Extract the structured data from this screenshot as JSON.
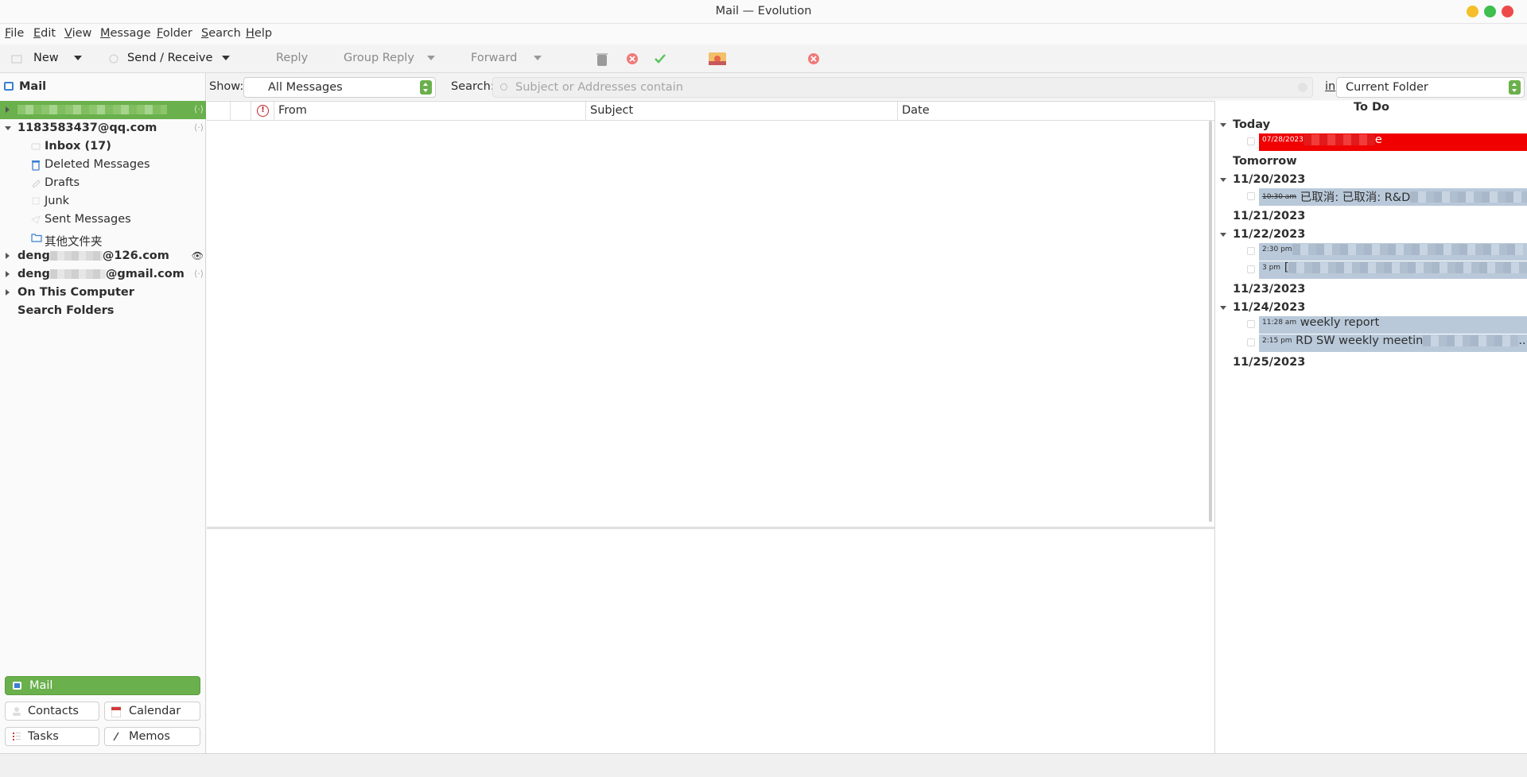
{
  "window": {
    "title": "Mail — Evolution"
  },
  "menu": [
    "File",
    "Edit",
    "View",
    "Message",
    "Folder",
    "Search",
    "Help"
  ],
  "toolbar": {
    "new_label": "New",
    "send_receive_label": "Send / Receive",
    "reply_label": "Reply",
    "group_reply_label": "Group Reply",
    "forward_label": "Forward"
  },
  "sidebar": {
    "header": "Mail",
    "accounts": [
      {
        "label_visible": ""
      },
      {
        "label": "1183583437@qq.com"
      },
      {
        "label_prefix": "deng",
        "label_suffix": "@126.com"
      },
      {
        "label_prefix": "deng",
        "label_suffix": "@gmail.com"
      },
      {
        "label": "On This Computer"
      },
      {
        "label": "Search Folders"
      }
    ],
    "folders": [
      {
        "label": "Inbox (17)",
        "icon": "inbox-icon"
      },
      {
        "label": "Deleted Messages",
        "icon": "trash-icon"
      },
      {
        "label": "Drafts",
        "icon": "drafts-icon"
      },
      {
        "label": "Junk",
        "icon": "junk-icon"
      },
      {
        "label": "Sent Messages",
        "icon": "sent-icon"
      },
      {
        "label": "其他文件夹",
        "icon": "folder-icon"
      }
    ]
  },
  "switcher": {
    "mail": "Mail",
    "contacts": "Contacts",
    "calendar": "Calendar",
    "tasks": "Tasks",
    "memos": "Memos"
  },
  "filter": {
    "show_label": "Show:",
    "show_value": "All Messages",
    "search_label": "Search:",
    "search_placeholder": "Subject or Addresses contain",
    "in_label": "in",
    "scope_value": "Current Folder"
  },
  "message_list": {
    "columns": [
      "From",
      "Subject",
      "Date"
    ]
  },
  "todo": {
    "title": "To Do",
    "days": [
      {
        "label": "Today"
      },
      {
        "label": "Tomorrow"
      },
      {
        "label": "11/20/2023"
      },
      {
        "label": "11/21/2023"
      },
      {
        "label": "11/22/2023"
      },
      {
        "label": "11/23/2023"
      },
      {
        "label": "11/24/2023"
      },
      {
        "label": "11/25/2023"
      }
    ],
    "events": [
      {
        "time": "07/28/2023",
        "subject_tail": "e"
      },
      {
        "time": "10:30 am",
        "subject": "已取消: 已取消: R&D"
      },
      {
        "time": "2:30 pm",
        "subject": ""
      },
      {
        "time": "3 pm",
        "subject": "["
      },
      {
        "time": "11:28 am",
        "subject": "weekly report"
      },
      {
        "time": "2:15 pm",
        "subject": "RD SW weekly meetin",
        "subject_tail": ".."
      }
    ]
  },
  "colors": {
    "accent_green": "#6ab04c",
    "overdue_red": "#f00000",
    "event_blue": "#b9c9da"
  }
}
